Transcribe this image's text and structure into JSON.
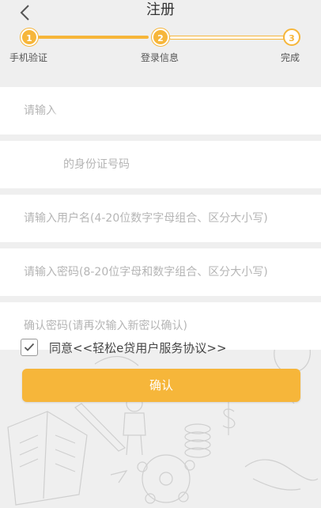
{
  "header": {
    "title": "注册",
    "back_icon": "chevron-left-icon"
  },
  "stepper": {
    "steps": [
      {
        "number": "1",
        "label": "手机验证",
        "state": "done"
      },
      {
        "number": "2",
        "label": "登录信息",
        "state": "current"
      },
      {
        "number": "3",
        "label": "完成",
        "state": "todo"
      }
    ]
  },
  "form": {
    "fields": [
      {
        "name": "realname",
        "placeholder": "请输入",
        "value": ""
      },
      {
        "name": "idcard",
        "placeholder": "的身份证号码",
        "value": ""
      },
      {
        "name": "username",
        "placeholder": "请输入用户名(4-20位数字字母组合、区分大小写)",
        "value": ""
      },
      {
        "name": "password",
        "placeholder": "请输入密码(8-20位字母和数字组合、区分大小写)",
        "value": ""
      },
      {
        "name": "confirm_password",
        "placeholder": "确认密码(请再次输入新密以确认)",
        "value": ""
      }
    ]
  },
  "agreement": {
    "checked": true,
    "prefix": "同意",
    "link_text": "<<轻松e贷用户服务协议>>"
  },
  "confirm_button": {
    "label": "确认"
  },
  "colors": {
    "accent": "#f6b63a",
    "background": "#efefef",
    "field_bg": "#ffffff",
    "placeholder": "#b5b5b5"
  }
}
